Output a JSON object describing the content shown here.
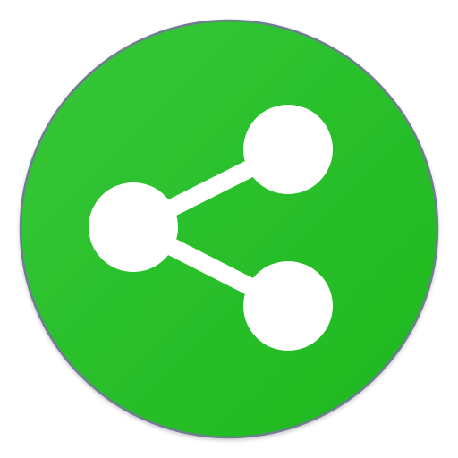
{
  "icon": {
    "name": "share-icon",
    "colors": {
      "background": "#ffffff",
      "circle_fill_light": "#36c738",
      "circle_fill_dark": "#1eb81e",
      "circle_border": "#6f7b93",
      "glyph": "#ffffff"
    }
  }
}
